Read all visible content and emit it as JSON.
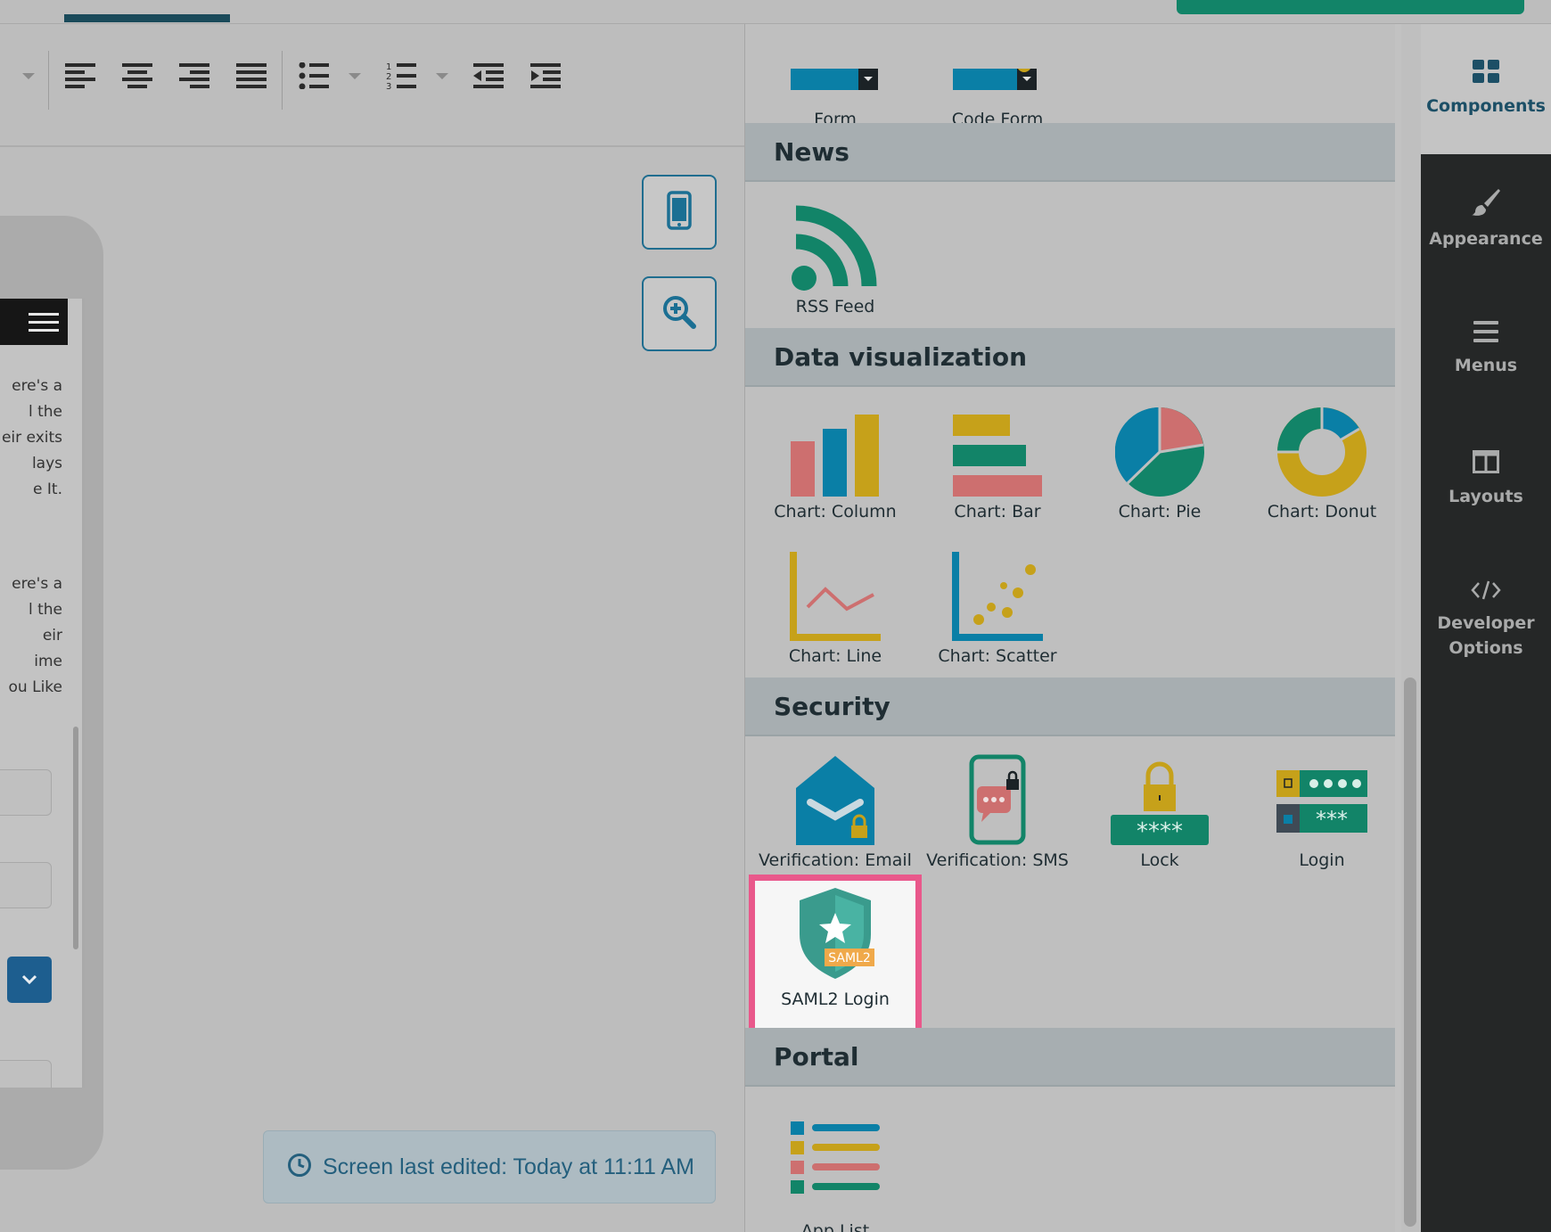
{
  "toolbar": {
    "align_left": "align-left-icon",
    "align_center": "align-center-icon",
    "align_right": "align-right-icon",
    "align_justify": "align-justify-icon",
    "bullet_list": "bullet-list-icon",
    "numbered_list": "numbered-list-icon",
    "outdent": "outdent-icon",
    "indent": "indent-icon"
  },
  "device_controls": {
    "mobile": "mobile-phone-icon",
    "zoom": "zoom-in-icon"
  },
  "phone_preview": {
    "paragraph_1": [
      "ere's a",
      "l the",
      "eir exits",
      "lays",
      "e It."
    ],
    "paragraph_2": [
      "ere's a",
      "l the",
      "eir",
      "ime",
      "ou Like"
    ]
  },
  "status": {
    "last_edited": "Screen last edited: Today at 11:11 AM"
  },
  "panel": {
    "top_items": [
      {
        "label": "Form",
        "icon": "form-icon"
      },
      {
        "label": "Code Form",
        "icon": "code-form-icon"
      }
    ],
    "sections": [
      {
        "title": "News",
        "items": [
          {
            "label": "RSS Feed",
            "icon": "rss-icon"
          }
        ]
      },
      {
        "title": "Data visualization",
        "items": [
          {
            "label": "Chart: Column",
            "icon": "column-chart-icon"
          },
          {
            "label": "Chart: Bar",
            "icon": "bar-chart-icon"
          },
          {
            "label": "Chart: Pie",
            "icon": "pie-chart-icon"
          },
          {
            "label": "Chart: Donut",
            "icon": "donut-chart-icon"
          },
          {
            "label": "Chart: Line",
            "icon": "line-chart-icon"
          },
          {
            "label": "Chart: Scatter",
            "icon": "scatter-chart-icon"
          }
        ]
      },
      {
        "title": "Security",
        "items": [
          {
            "label": "Verification: Email",
            "icon": "email-verification-icon"
          },
          {
            "label": "Verification: SMS",
            "icon": "sms-verification-icon"
          },
          {
            "label": "Lock",
            "icon": "lock-icon"
          },
          {
            "label": "Login",
            "icon": "login-icon"
          },
          {
            "label": "SAML2 Login",
            "icon": "saml2-shield-icon",
            "badge": "SAML2",
            "selected": true
          }
        ]
      },
      {
        "title": "Portal",
        "items": [
          {
            "label": "App List",
            "icon": "app-list-icon"
          }
        ]
      }
    ]
  },
  "rail": {
    "items": [
      {
        "label": "Components",
        "icon": "components-icon",
        "active": true
      },
      {
        "label": "Appearance",
        "icon": "paintbrush-icon"
      },
      {
        "label": "Menus",
        "icon": "menu-icon"
      },
      {
        "label": "Layouts",
        "icon": "layout-icon"
      },
      {
        "label": "Developer Options",
        "icon": "code-icon"
      }
    ]
  },
  "colors": {
    "teal": "#128468",
    "blue": "#0a7fa6",
    "gold": "#c6a11a",
    "rose": "#cd6f6f",
    "accent_dark": "#1c4f66",
    "selection": "#e9588b"
  }
}
